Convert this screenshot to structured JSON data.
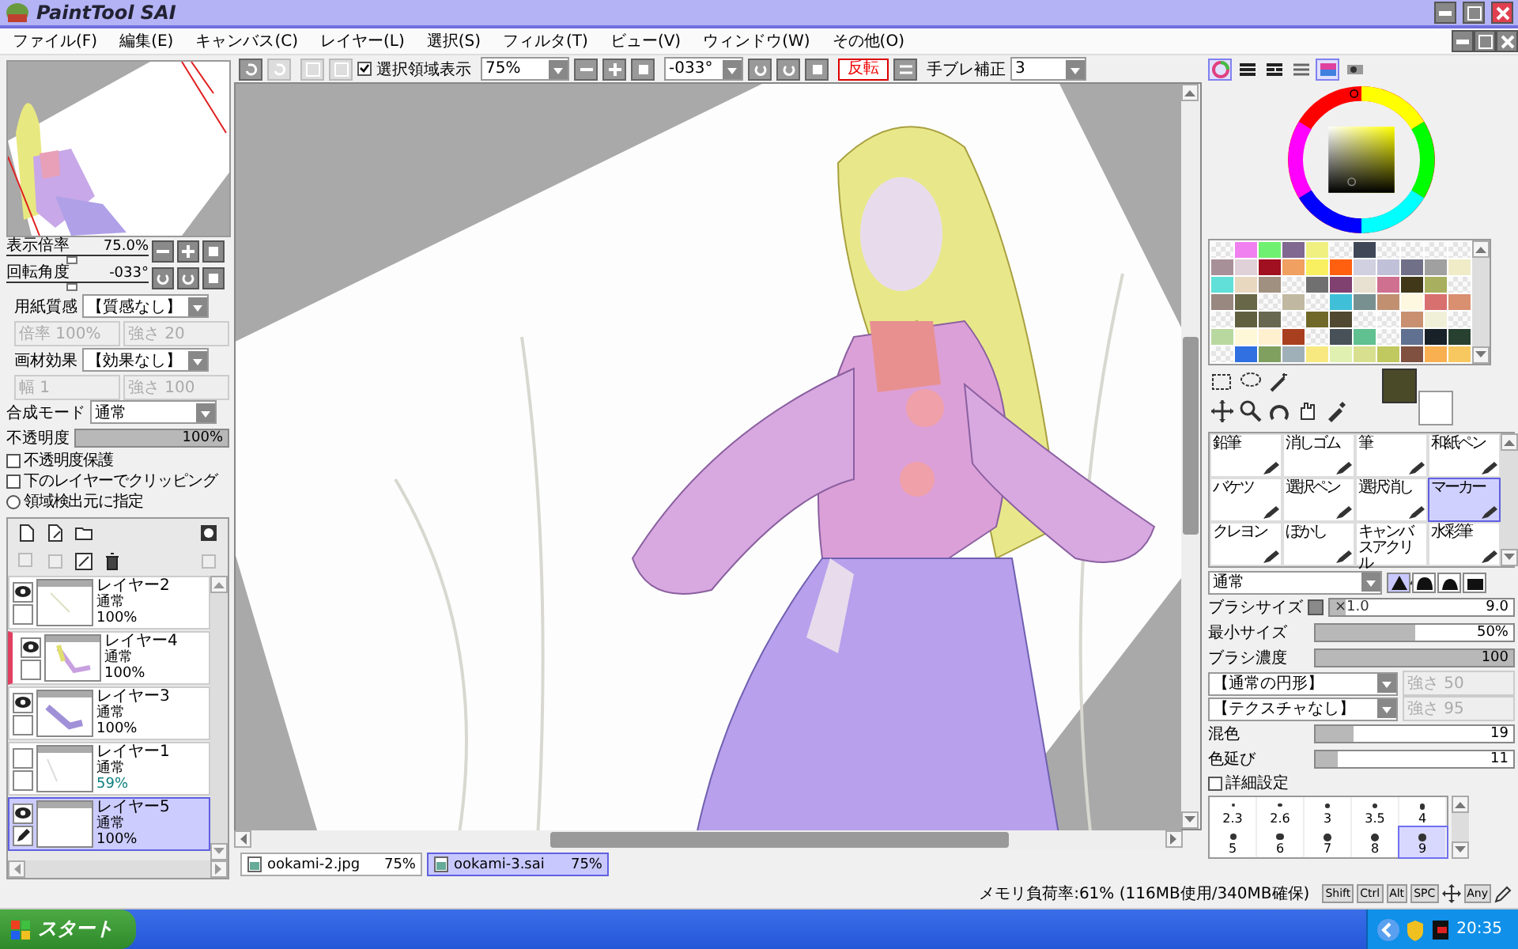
{
  "title_bar": {
    "logo": "PaintTool SAI"
  },
  "menu": [
    "ファイル(F)",
    "編集(E)",
    "キャンバス(C)",
    "レイヤー(L)",
    "選択(S)",
    "フィルタ(T)",
    "ビュー(V)",
    "ウィンドウ(W)",
    "その他(O)"
  ],
  "toolbar": {
    "show_selection": {
      "label": "選択領域表示",
      "checked": true
    },
    "zoom": "75%",
    "angle": "-033°",
    "flip": "反転",
    "stabilizer": {
      "label": "手ブレ補正",
      "value": "3"
    }
  },
  "navigator": [
    {
      "label": "表示倍率",
      "value": "75.0%",
      "level": 0.45
    },
    {
      "label": "回転角度",
      "value": "-033°",
      "level": 0.45
    }
  ],
  "paper": [
    {
      "label": "用紙質感",
      "value": "【質感なし】",
      "params": [
        {
          "label": "倍率",
          "value": "100%",
          "disabled": true
        },
        {
          "label": "強さ",
          "value": "20",
          "disabled": true
        }
      ]
    },
    {
      "label": "画材効果",
      "value": "【効果なし】",
      "params": [
        {
          "label": "幅",
          "value": "1",
          "disabled": true
        },
        {
          "label": "強さ",
          "value": "100",
          "disabled": true
        }
      ]
    }
  ],
  "blend_mode": {
    "label": "合成モード",
    "value": "通常"
  },
  "opacity": {
    "label": "不透明度",
    "value": "100%",
    "level": 1
  },
  "options": [
    {
      "kind": "checkbox",
      "label": "不透明度保護",
      "checked": false
    },
    {
      "kind": "checkbox",
      "label": "下のレイヤーでクリッピング",
      "checked": false
    },
    {
      "kind": "radio",
      "label": "領域検出元に指定",
      "checked": false
    }
  ],
  "layers": [
    {
      "name": "レイヤー2",
      "mode": "通常",
      "opacity": "100%",
      "visible": true,
      "selected": false,
      "marked": false,
      "reduced": false,
      "editing": false
    },
    {
      "name": "レイヤー4",
      "mode": "通常",
      "opacity": "100%",
      "visible": true,
      "selected": false,
      "marked": true,
      "reduced": false,
      "editing": false
    },
    {
      "name": "レイヤー3",
      "mode": "通常",
      "opacity": "100%",
      "visible": true,
      "selected": false,
      "marked": false,
      "reduced": false,
      "editing": false
    },
    {
      "name": "レイヤー1",
      "mode": "通常",
      "opacity": "59%",
      "visible": false,
      "selected": false,
      "marked": false,
      "reduced": true,
      "editing": false
    },
    {
      "name": "レイヤー5",
      "mode": "通常",
      "opacity": "100%",
      "visible": true,
      "selected": true,
      "marked": false,
      "reduced": false,
      "editing": true
    }
  ],
  "documents": [
    {
      "name": "ookami-2.jpg",
      "zoom": "75%",
      "selected": false
    },
    {
      "name": "ookami-3.sai",
      "zoom": "75%",
      "selected": true
    }
  ],
  "color_tabs": [
    {
      "kind": "wheel",
      "selected": true
    },
    {
      "kind": "rgb",
      "selected": false
    },
    {
      "kind": "hsv",
      "selected": false
    },
    {
      "kind": "mixer",
      "selected": false
    },
    {
      "kind": "swatches",
      "selected": true
    },
    {
      "kind": "scratch",
      "selected": false
    }
  ],
  "palette": [
    {
      "kind": "empty"
    },
    {
      "kind": "color",
      "color": "#f080f0"
    },
    {
      "kind": "color",
      "color": "#70f070"
    },
    {
      "kind": "color",
      "color": "#806890"
    },
    {
      "kind": "color",
      "color": "#f0f080"
    },
    {
      "kind": "empty"
    },
    {
      "kind": "color",
      "color": "#404858"
    },
    {
      "kind": "empty"
    },
    {
      "kind": "empty"
    },
    {
      "kind": "empty"
    },
    {
      "kind": "empty"
    },
    {
      "kind": "color",
      "color": "#a89098"
    },
    {
      "kind": "color",
      "color": "#e0d0d8"
    },
    {
      "kind": "color",
      "color": "#a01020"
    },
    {
      "kind": "color",
      "color": "#f0a060"
    },
    {
      "kind": "color",
      "color": "#f8f060"
    },
    {
      "kind": "color",
      "color": "#ff6010"
    },
    {
      "kind": "color",
      "color": "#d0d0e0"
    },
    {
      "kind": "color",
      "color": "#c0c0d8"
    },
    {
      "kind": "color",
      "color": "#707088"
    },
    {
      "kind": "color",
      "color": "#a0a0a0"
    },
    {
      "kind": "color",
      "color": "#f0ecc8"
    },
    {
      "kind": "color",
      "color": "#60e0d8"
    },
    {
      "kind": "color",
      "color": "#e8d8c0"
    },
    {
      "kind": "color",
      "color": "#a09080"
    },
    {
      "kind": "empty"
    },
    {
      "kind": "color",
      "color": "#707070"
    },
    {
      "kind": "color",
      "color": "#804070"
    },
    {
      "kind": "color",
      "color": "#e8e0d0"
    },
    {
      "kind": "color",
      "color": "#d07090"
    },
    {
      "kind": "color",
      "color": "#403818"
    },
    {
      "kind": "color",
      "color": "#a8b060"
    },
    {
      "kind": "empty"
    },
    {
      "kind": "color",
      "color": "#988880"
    },
    {
      "kind": "color",
      "color": "#686848"
    },
    {
      "kind": "empty"
    },
    {
      "kind": "color",
      "color": "#c0b8a0"
    },
    {
      "kind": "empty"
    },
    {
      "kind": "color",
      "color": "#40c0d8"
    },
    {
      "kind": "color",
      "color": "#789090"
    },
    {
      "kind": "color",
      "color": "#c09070"
    },
    {
      "kind": "color",
      "color": "#fff8e0"
    },
    {
      "kind": "color",
      "color": "#d87070"
    },
    {
      "kind": "color",
      "color": "#d89070"
    },
    {
      "kind": "empty"
    },
    {
      "kind": "color",
      "color": "#606040"
    },
    {
      "kind": "color",
      "color": "#686850"
    },
    {
      "kind": "empty"
    },
    {
      "kind": "color",
      "color": "#706828"
    },
    {
      "kind": "color",
      "color": "#504830"
    },
    {
      "kind": "empty"
    },
    {
      "kind": "empty"
    },
    {
      "kind": "color",
      "color": "#c89070"
    },
    {
      "kind": "color",
      "color": "#f0f0d8"
    },
    {
      "kind": "empty"
    },
    {
      "kind": "color",
      "color": "#b8d8a0"
    },
    {
      "kind": "color",
      "color": "#fff8d8"
    },
    {
      "kind": "color",
      "color": "#fff0d0"
    },
    {
      "kind": "color",
      "color": "#a84020"
    },
    {
      "kind": "empty"
    },
    {
      "kind": "color",
      "color": "#485058"
    },
    {
      "kind": "color",
      "color": "#60c090"
    },
    {
      "kind": "empty"
    },
    {
      "kind": "color",
      "color": "#607090"
    },
    {
      "kind": "color",
      "color": "#182028"
    },
    {
      "kind": "color",
      "color": "#284030"
    },
    {
      "kind": "empty"
    },
    {
      "kind": "color",
      "color": "#3070e0"
    },
    {
      "kind": "color",
      "color": "#80a060"
    },
    {
      "kind": "color",
      "color": "#a0b0b8"
    },
    {
      "kind": "color",
      "color": "#f8e880"
    },
    {
      "kind": "color",
      "color": "#e0f0b0"
    },
    {
      "kind": "color",
      "color": "#d8e090"
    },
    {
      "kind": "color",
      "color": "#c0c860"
    },
    {
      "kind": "color",
      "color": "#805040"
    },
    {
      "kind": "color",
      "color": "#f8b050"
    },
    {
      "kind": "color",
      "color": "#f8c860"
    }
  ],
  "colors": [
    {
      "kind": "primary",
      "color": "#4b4a28"
    },
    {
      "kind": "secondary",
      "color": "#ffffff"
    }
  ],
  "brushes": [
    {
      "name": "鉛筆",
      "selected": false
    },
    {
      "name": "消しゴム",
      "selected": false
    },
    {
      "name": "筆",
      "selected": false
    },
    {
      "name": "和紙ペン",
      "selected": false
    },
    {
      "name": "バケツ",
      "selected": false
    },
    {
      "name": "選択ペン",
      "selected": false
    },
    {
      "name": "選択消し",
      "selected": false
    },
    {
      "name": "マーカー",
      "selected": true
    },
    {
      "name": "クレヨン",
      "selected": false
    },
    {
      "name": "ぼかし",
      "selected": false
    },
    {
      "name": "キャンバスアクリル",
      "selected": false
    },
    {
      "name": "水彩筆",
      "selected": false
    }
  ],
  "brush_settings": {
    "mode": "通常",
    "tips": [
      {
        "kind": "sharp",
        "selected": true
      },
      {
        "kind": "round",
        "selected": false
      },
      {
        "kind": "flat",
        "selected": false
      },
      {
        "kind": "square",
        "selected": false
      }
    ],
    "size": {
      "label": "ブラシサイズ",
      "multiplier": "×1.0",
      "value": "9.0",
      "level": 0.09
    },
    "sliders": [
      {
        "label": "最小サイズ",
        "value": "50%",
        "level": 0.5
      },
      {
        "label": "ブラシ濃度",
        "value": "100",
        "level": 1
      }
    ],
    "shapes": [
      {
        "value": "【通常の円形】",
        "param": "強さ",
        "param_value": "50"
      },
      {
        "value": "【テクスチャなし】",
        "param": "強さ",
        "param_value": "95"
      }
    ],
    "mix": [
      {
        "label": "混色",
        "value": "19",
        "level": 0.19
      },
      {
        "label": "色延び",
        "value": "11",
        "level": 0.11
      }
    ],
    "advanced": {
      "label": "詳細設定",
      "checked": false
    }
  },
  "sizes": [
    {
      "value": "2.3",
      "selected": false
    },
    {
      "value": "2.6",
      "selected": false
    },
    {
      "value": "3",
      "selected": false
    },
    {
      "value": "3.5",
      "selected": false
    },
    {
      "value": "4",
      "selected": false
    },
    {
      "value": "5",
      "selected": false
    },
    {
      "value": "6",
      "selected": false
    },
    {
      "value": "7",
      "selected": false
    },
    {
      "value": "8",
      "selected": false
    },
    {
      "value": "9",
      "selected": true
    }
  ],
  "status": {
    "memory": "メモリ負荷率:61% (116MB使用/340MB確保)",
    "keys": [
      "Shift",
      "Ctrl",
      "Alt",
      "SPC"
    ],
    "any": "Any"
  },
  "taskbar": {
    "start": "スタート",
    "clock": "20:35"
  }
}
